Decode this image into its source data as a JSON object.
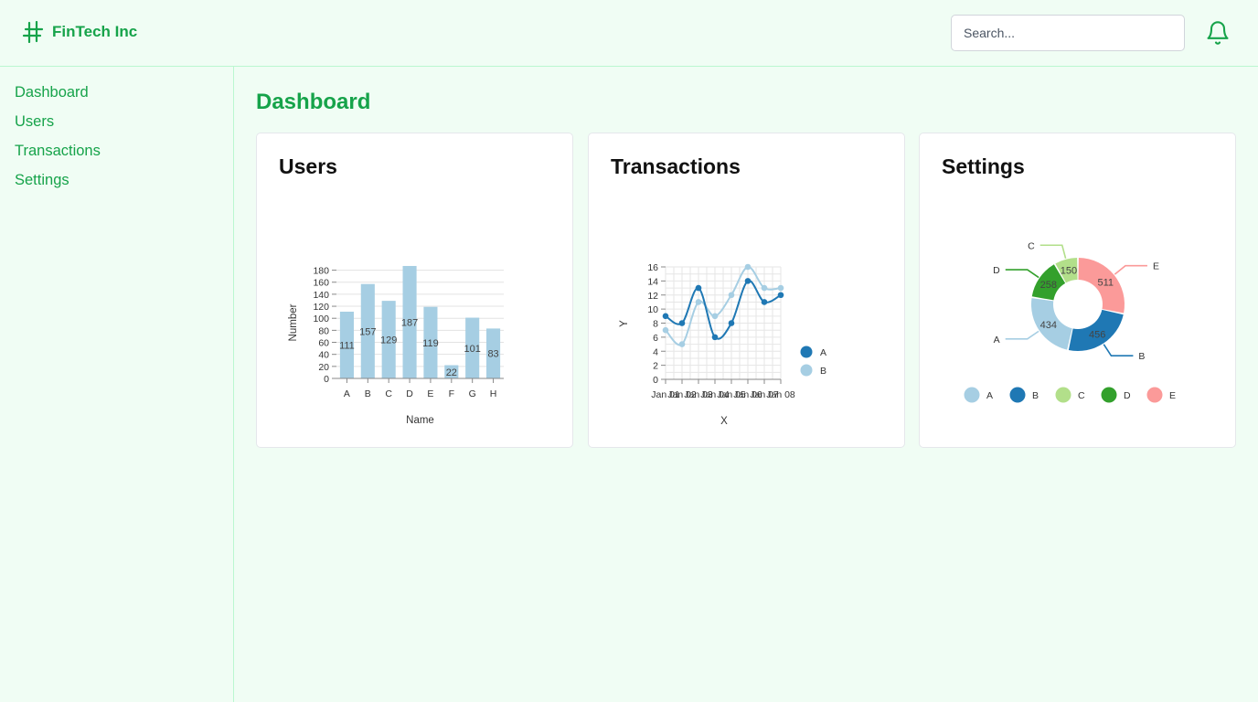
{
  "header": {
    "brand": "FinTech Inc",
    "search_placeholder": "Search..."
  },
  "icons": {
    "logo": "hashtag-icon",
    "notifications": "bell-icon"
  },
  "colors": {
    "brand": "#16a34a",
    "background": "#f0fdf4",
    "bar": "#a6cee3",
    "line_a": "#1f78b4",
    "line_b": "#a6cee3"
  },
  "sidebar": {
    "items": [
      {
        "label": "Dashboard"
      },
      {
        "label": "Users"
      },
      {
        "label": "Transactions"
      },
      {
        "label": "Settings"
      }
    ]
  },
  "main": {
    "title": "Dashboard",
    "cards": [
      {
        "title": "Users"
      },
      {
        "title": "Transactions"
      },
      {
        "title": "Settings"
      }
    ]
  },
  "chart_data": [
    {
      "type": "bar",
      "categories": [
        "A",
        "B",
        "C",
        "D",
        "E",
        "F",
        "G",
        "H"
      ],
      "values": [
        111,
        157,
        129,
        187,
        119,
        22,
        101,
        83
      ],
      "xlabel": "Name",
      "ylabel": "Number",
      "ylim": [
        0,
        190
      ],
      "yticks": [
        0,
        20,
        40,
        60,
        80,
        100,
        120,
        140,
        160,
        180
      ],
      "data_labels": true,
      "grid": true
    },
    {
      "type": "line",
      "x": [
        "Jan 01",
        "Jan 02",
        "Jan 03",
        "Jan 04",
        "Jan 05",
        "Jan 06",
        "Jan 07",
        "Jan 08"
      ],
      "xtick_labels": [
        "Jan 01",
        "Jan 02",
        "Jan 03",
        "Jan 04",
        "Jan 05",
        "Jan 06",
        "Jan 07",
        "Jan 08"
      ],
      "series": [
        {
          "name": "A",
          "values": [
            9,
            8,
            13,
            6,
            8,
            14,
            11,
            12
          ]
        },
        {
          "name": "B",
          "values": [
            7,
            5,
            11,
            9,
            12,
            16,
            13,
            13
          ]
        }
      ],
      "xlabel": "X",
      "ylabel": "Y",
      "ylim": [
        0,
        16
      ],
      "yticks": [
        0,
        2,
        4,
        6,
        8,
        10,
        12,
        14,
        16
      ],
      "grid": true,
      "legend": "right"
    },
    {
      "type": "pie",
      "donut": true,
      "categories": [
        "A",
        "B",
        "C",
        "D",
        "E"
      ],
      "values": [
        434,
        456,
        150,
        258,
        511
      ],
      "colors": [
        "#a6cee3",
        "#1f78b4",
        "#b2df8a",
        "#33a02c",
        "#fb9a99"
      ],
      "legend": "bottom"
    }
  ]
}
